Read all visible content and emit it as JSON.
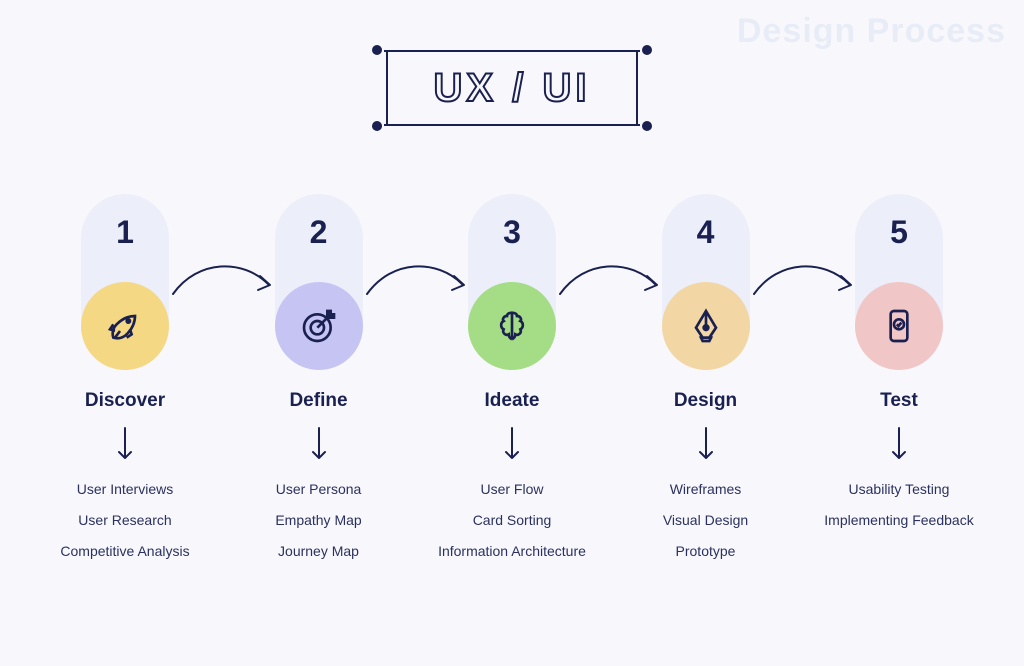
{
  "watermark": "Design Process",
  "badge_text": "UX / UI",
  "stages": [
    {
      "num": "1",
      "title": "Discover",
      "icon": "rocket-icon",
      "color": "#f4d884",
      "tasks": [
        "User Interviews",
        "User Research",
        "Competitive Analysis"
      ]
    },
    {
      "num": "2",
      "title": "Define",
      "icon": "target-icon",
      "color": "#c6c4f2",
      "tasks": [
        "User Persona",
        "Empathy Map",
        "Journey Map"
      ]
    },
    {
      "num": "3",
      "title": "Ideate",
      "icon": "brain-icon",
      "color": "#a4dd86",
      "tasks": [
        "User Flow",
        "Card Sorting",
        "Information Architecture"
      ]
    },
    {
      "num": "4",
      "title": "Design",
      "icon": "pen-icon",
      "color": "#f2d7a5",
      "tasks": [
        "Wireframes",
        "Visual Design",
        "Prototype"
      ]
    },
    {
      "num": "5",
      "title": "Test",
      "icon": "phone-check-icon",
      "color": "#f1c6c6",
      "tasks": [
        "Usability Testing",
        "Implementing Feedback"
      ]
    }
  ]
}
